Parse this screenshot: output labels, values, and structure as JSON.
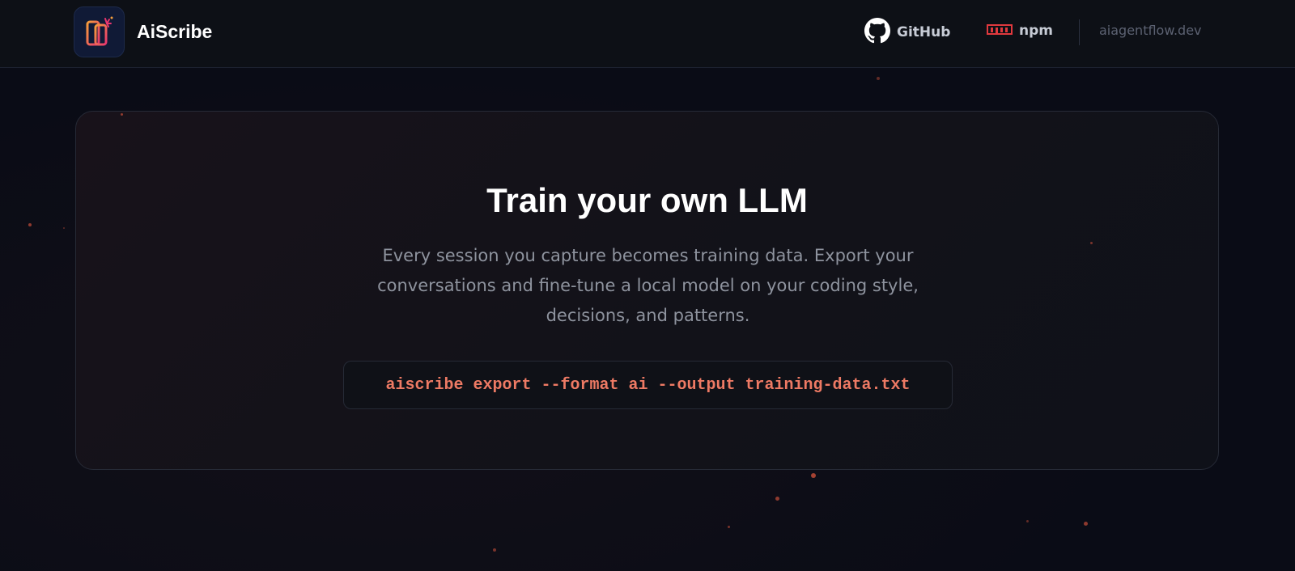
{
  "header": {
    "brand_name": "AiScribe",
    "nav": {
      "github_label": "GitHub",
      "npm_label": "npm",
      "site_label": "aiagentflow.dev"
    }
  },
  "card": {
    "title": "Train your own LLM",
    "description": "Every session you capture becomes training data. Export your conversations and fine-tune a local model on your coding style, decisions, and patterns.",
    "command": "aiscribe export --format ai --output training-data.txt"
  },
  "icons": {
    "logo": "aiscribe-logo-icon",
    "github": "github-icon",
    "npm": "npm-icon"
  },
  "colors": {
    "background": "#0a0c16",
    "accent": "#ee7a64",
    "npm_red": "#e0393e"
  }
}
